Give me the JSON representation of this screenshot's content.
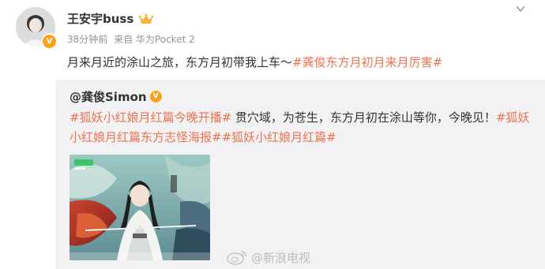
{
  "post": {
    "author_name": "王安宇buss",
    "time": "38分钟前",
    "source": "来自 华为Pocket 2",
    "content_plain": "月来月近的涂山之旅，东方月初带我上车～",
    "content_topic": "#龚俊东方月初月来月厉害#"
  },
  "repost": {
    "author_name": "@龚俊Simon",
    "topic_1": "#狐妖小红娘月红篇今晚开播#",
    "text_plain": " 贯穴域，为苍生，东方月初在涂山等你，今晚见！",
    "topic_2": "#狐妖小红娘月红篇东方志怪海报#",
    "topic_3": "#狐妖小红娘月红篇#"
  },
  "watermark": {
    "text": "@新浪电视"
  },
  "colors": {
    "topic": "#eb7350",
    "repost_bg": "#f2f2f5",
    "badge": "#f7a41c",
    "meta": "#939393"
  },
  "icons": {
    "verified": "verified-v-icon",
    "crown": "crown-icon",
    "menu": "chevron-down-icon",
    "weibo": "weibo-logo-icon"
  }
}
